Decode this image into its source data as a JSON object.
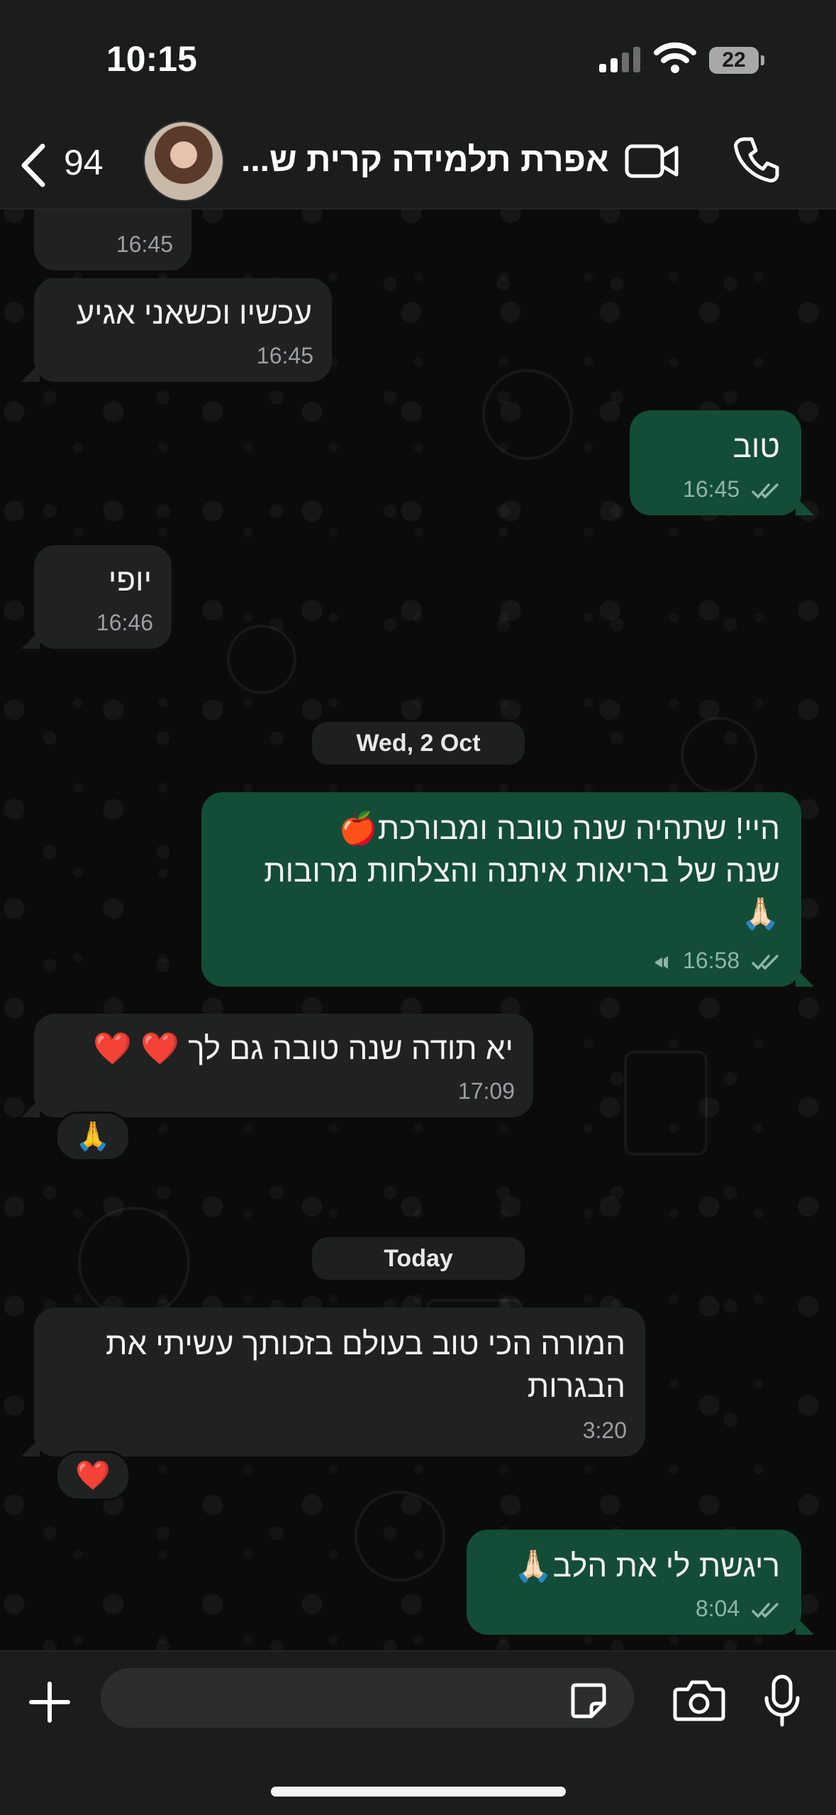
{
  "status_bar": {
    "time": "10:15",
    "battery": "22"
  },
  "header": {
    "unread_count": "94",
    "contact_name": "אפרת תלמידה קרית ש..."
  },
  "messages": {
    "m0": {
      "partial_text": "...",
      "time": "16:45"
    },
    "m1": {
      "text": "עכשיו וכשאני אגיע",
      "time": "16:45"
    },
    "m2": {
      "text": "טוב",
      "time": "16:45"
    },
    "m3": {
      "text": "יופי",
      "time": "16:46"
    },
    "date1": "Wed, 2 Oct",
    "m4": {
      "line1": "היי! שתהיה שנה טובה ומבורכת🍎",
      "line2": "שנה של בריאות איתנה והצלחות מרובות",
      "line3": "🙏🏻",
      "time": "16:58"
    },
    "m5": {
      "text": "יא תודה שנה טובה גם לך ❤️ ❤️",
      "time": "17:09",
      "reaction": "🙏"
    },
    "date2": "Today",
    "m6": {
      "line1": "המורה הכי טוב בעולם בזכותך עשיתי את",
      "line2": "הבגרות",
      "time": "3:20",
      "reaction": "❤️"
    },
    "m7": {
      "text": "ריגשת לי את הלב🙏🏻",
      "time": "8:04"
    }
  },
  "input": {
    "placeholder": ""
  },
  "colors": {
    "incoming_bubble": "#202222",
    "outgoing_bubble": "#134d37",
    "bar_background": "#1b1c1c"
  },
  "icons": [
    "back-icon",
    "video-icon",
    "call-icon",
    "plus-icon",
    "sticker-icon",
    "camera-icon",
    "mic-icon",
    "read-ticks-icon",
    "forward-icon"
  ]
}
